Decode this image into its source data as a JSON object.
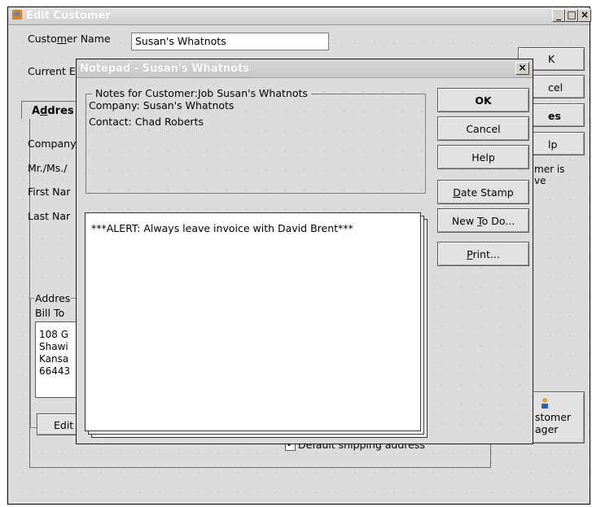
{
  "window": {
    "title": "Edit Customer",
    "caption_buttons": [
      "_",
      "□",
      "×"
    ]
  },
  "customer": {
    "name_label_pre": "Custo",
    "name_label_ul": "m",
    "name_label_post": "er Name",
    "name_value": "Susan's Whatnots",
    "current_balance_label": "Current E"
  },
  "right_buttons": {
    "ok": "K",
    "cancel": "cel",
    "notes": "es",
    "help": "lp",
    "inactive_text_1": "mer is",
    "inactive_text_2": "ve"
  },
  "tab": {
    "address_pre": "A",
    "address_ul": "d",
    "address_post": "dres"
  },
  "form_labels": {
    "company": "Company",
    "mr_ms": "Mr./Ms./",
    "first": "First Nar",
    "last": "Last Nar"
  },
  "address": {
    "group_label": "Addres",
    "bill_to": "Bill To",
    "lines": [
      "108 G",
      "Shawi",
      "Kansa",
      "66443"
    ],
    "edit_button": "Edit"
  },
  "shipping": {
    "default_label": "Default shipping address"
  },
  "manager": {
    "line1": "stomer",
    "line2": "ager"
  },
  "notepad": {
    "title": "Notepad - Susan's Whatnots",
    "close": "×",
    "group_label": "Notes for Customer:Job Susan's Whatnots",
    "company_line": "Company: Susan's Whatnots",
    "contact_line": "Contact: Chad Roberts",
    "note_text": "***ALERT: Always leave invoice with David Brent***",
    "buttons": {
      "ok": "OK",
      "cancel": "Cancel",
      "help": "Help",
      "date_stamp_ul": "D",
      "date_stamp_rest": "ate Stamp",
      "new_todo_pre": "New ",
      "new_todo_ul": "T",
      "new_todo_rest": "o Do...",
      "print_ul": "P",
      "print_rest": "rint..."
    }
  }
}
